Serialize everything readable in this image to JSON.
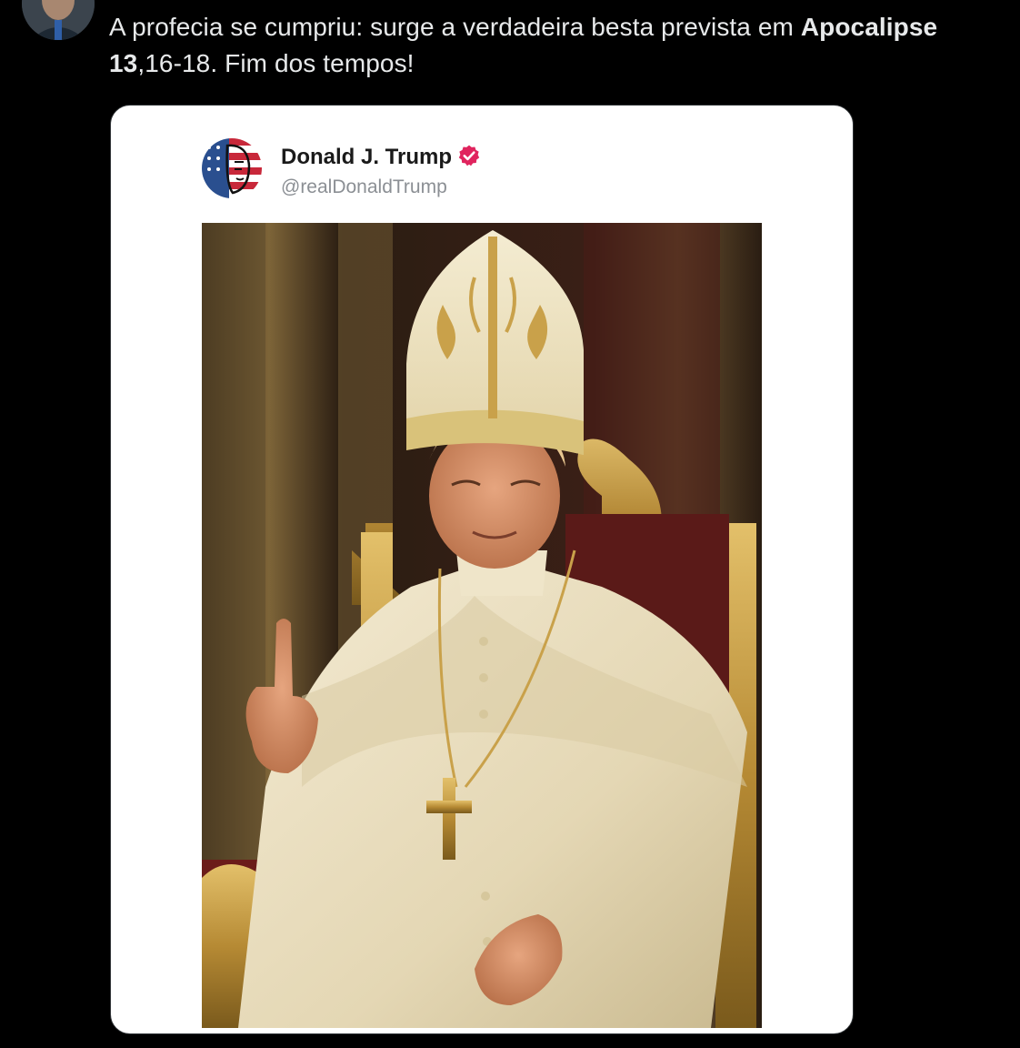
{
  "tweet": {
    "text_before": "A profecia se cumpriu: surge a verdadeira besta prevista em ",
    "text_bold_1": "Apocalipse 13",
    "text_middle": ",16-18. Fim dos tempos!",
    "author_avatar_icon": "user-avatar-photo"
  },
  "embedded_post": {
    "display_name": "Donald J. Trump",
    "handle": "@realDonaldTrump",
    "verified_icon": "verified-badge-icon",
    "verified_color": "#e0245e",
    "avatar_icon": "flag-face-avatar",
    "image_icon": "papal-portrait-image"
  },
  "colors": {
    "background": "#000000",
    "tweet_text": "#e7e9ea",
    "card_background": "#ffffff",
    "name_text": "#1a1a1a",
    "handle_text": "#8b8f94"
  }
}
